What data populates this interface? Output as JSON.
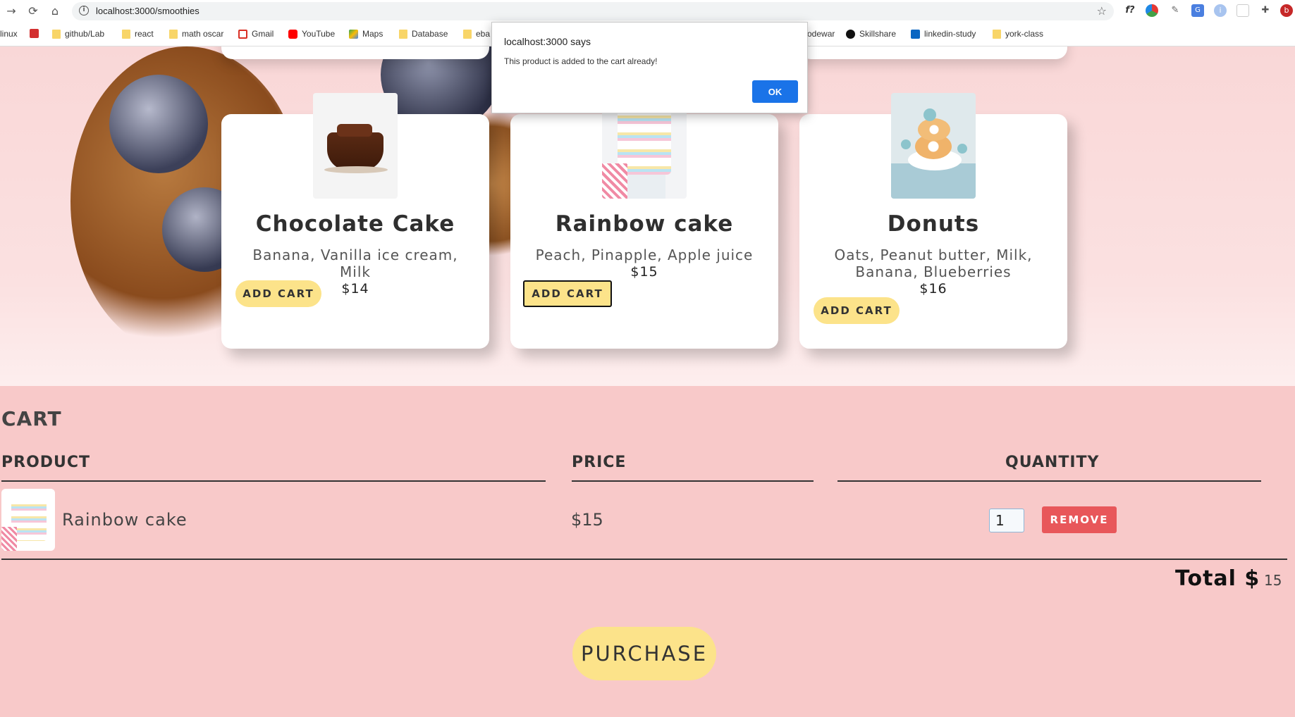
{
  "browser": {
    "url": "localhost:3000/smoothies",
    "bookmarks": [
      "linux",
      "github/Lab",
      "react",
      "math oscar",
      "Gmail",
      "YouTube",
      "Maps",
      "Database",
      "eba",
      "odewar",
      "Skillshare",
      "linkedin-study",
      "york-class"
    ]
  },
  "dialog": {
    "title": "localhost:3000 says",
    "message": "This product is added to the cart already!",
    "ok_label": "OK"
  },
  "products": [
    {
      "name": "Chocolate Cake",
      "ingredients": "Banana, Vanilla ice cream, Milk",
      "price": "$14",
      "button": "ADD CART"
    },
    {
      "name": "Rainbow cake",
      "ingredients": "Peach, Pinapple, Apple juice",
      "price": "$15",
      "button": "ADD CART"
    },
    {
      "name": "Donuts",
      "ingredients": "Oats, Peanut butter, Milk, Banana, Blueberries",
      "price": "$16",
      "button": "ADD CART"
    }
  ],
  "cart": {
    "title": "CART",
    "headers": {
      "product": "PRODUCT",
      "price": "PRICE",
      "quantity": "QUANTITY"
    },
    "items": [
      {
        "name": "Rainbow cake",
        "price": "$15",
        "quantity": "1",
        "remove_label": "REMOVE"
      }
    ],
    "total_label": "Total $",
    "total_value": "15",
    "purchase_label": "PURCHASE"
  },
  "colors": {
    "accent_yellow": "#fce38a",
    "remove_red": "#e8575a",
    "cart_bg": "#f8c9c9",
    "ok_blue": "#1a73e8"
  }
}
